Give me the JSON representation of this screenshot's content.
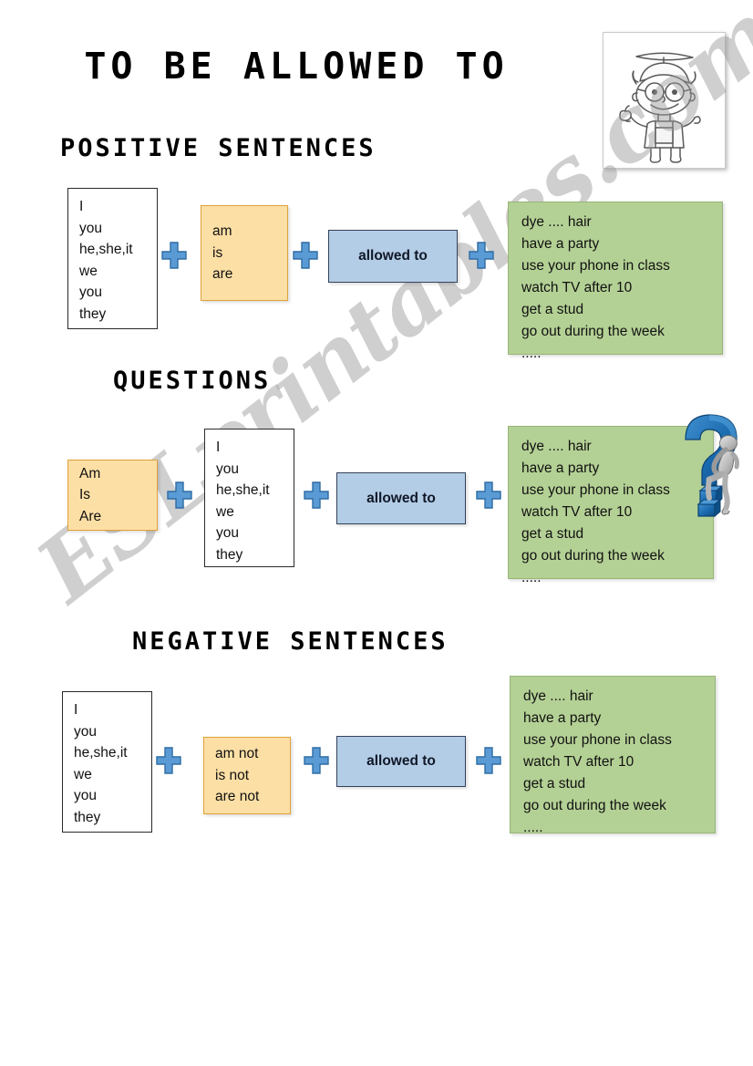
{
  "page": {
    "title": "TO BE ALLOWED TO",
    "watermark": "ESLprintables.com"
  },
  "colors": {
    "pronoun_box_fill": "#ffffff",
    "pronoun_box_border": "#2a2a2a",
    "aux_box_fill": "#fcdfa5",
    "aux_box_border": "#dfa13a",
    "allowed_box_fill": "#b4cde6",
    "allowed_box_border": "#34425a",
    "green_box_fill": "#b4d195",
    "green_box_border": "#96b478",
    "plus_icon_fill": "#5b9bd5",
    "plus_icon_border": "#2e6ca4",
    "watermark_grey": "#969696"
  },
  "header_image": {
    "name": "boy-with-propeller-hat-illustration",
    "description": "line drawing of a boy with glasses and propeller beanie"
  },
  "sections": [
    {
      "id": "positive",
      "heading": "POSITIVE SENTENCES",
      "pronouns": "I\nyou\nhe,she,it\nwe\nyou\nthey",
      "aux": "am\nis\nare",
      "allowed": "allowed to",
      "actions": "dye .... hair\nhave a party\nuse your phone in class\nwatch TV after 10\nget a stud\ngo out during the week\n....."
    },
    {
      "id": "questions",
      "heading": "QUESTIONS",
      "aux": "Am\nIs\nAre",
      "pronouns": "I\nyou\nhe,she,it\nwe\nyou\nthey",
      "allowed": "allowed to",
      "actions": "dye .... hair\nhave a party\nuse your phone in class\nwatch TV after 10\nget a stud\ngo out during the week\n....."
    },
    {
      "id": "negative",
      "heading": "NEGATIVE SENTENCES",
      "pronouns": "I\nyou\nhe,she,it\nwe\nyou\nthey",
      "aux": "am not\nis not\nare not",
      "allowed": "allowed to",
      "actions": "dye .... hair\nhave a party\nuse your phone in class\nwatch TV after 10\nget a stud\ngo out during the week\n....."
    }
  ],
  "icons": {
    "plus": "plus-icon",
    "question_mark": "question-mark-thinker-icon"
  }
}
